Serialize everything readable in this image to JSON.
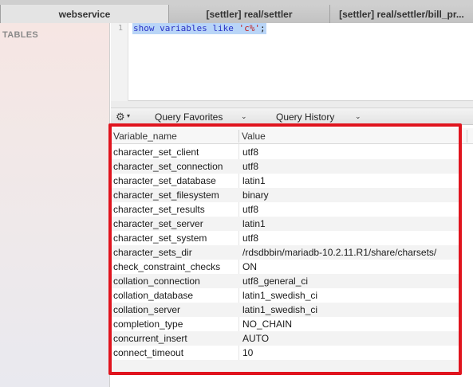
{
  "tabs": [
    {
      "label": "webservice",
      "state": "active"
    },
    {
      "label": "[settler] real/settler",
      "state": "inactive"
    },
    {
      "label": "[settler] real/settler/bill_pr...",
      "state": "inactive"
    }
  ],
  "sidebar": {
    "title": "TABLES"
  },
  "editor": {
    "line_number": "1",
    "query": {
      "kw1": "show",
      "kw2": "variables",
      "kw3": "like",
      "str": "'c%'",
      "end": ";"
    }
  },
  "toolbar": {
    "gear_icon": "gear-icon",
    "query_favorites": "Query Favorites",
    "query_history": "Query History"
  },
  "results": {
    "columns": [
      "Variable_name",
      "Value"
    ],
    "rows": [
      [
        "character_set_client",
        "utf8"
      ],
      [
        "character_set_connection",
        "utf8"
      ],
      [
        "character_set_database",
        "latin1"
      ],
      [
        "character_set_filesystem",
        "binary"
      ],
      [
        "character_set_results",
        "utf8"
      ],
      [
        "character_set_server",
        "latin1"
      ],
      [
        "character_set_system",
        "utf8"
      ],
      [
        "character_sets_dir",
        "/rdsdbbin/mariadb-10.2.11.R1/share/charsets/"
      ],
      [
        "check_constraint_checks",
        "ON"
      ],
      [
        "collation_connection",
        "utf8_general_ci"
      ],
      [
        "collation_database",
        "latin1_swedish_ci"
      ],
      [
        "collation_server",
        "latin1_swedish_ci"
      ],
      [
        "completion_type",
        "NO_CHAIN"
      ],
      [
        "concurrent_insert",
        "AUTO"
      ],
      [
        "connect_timeout",
        "10"
      ]
    ]
  },
  "highlight_color": "#e0141e"
}
